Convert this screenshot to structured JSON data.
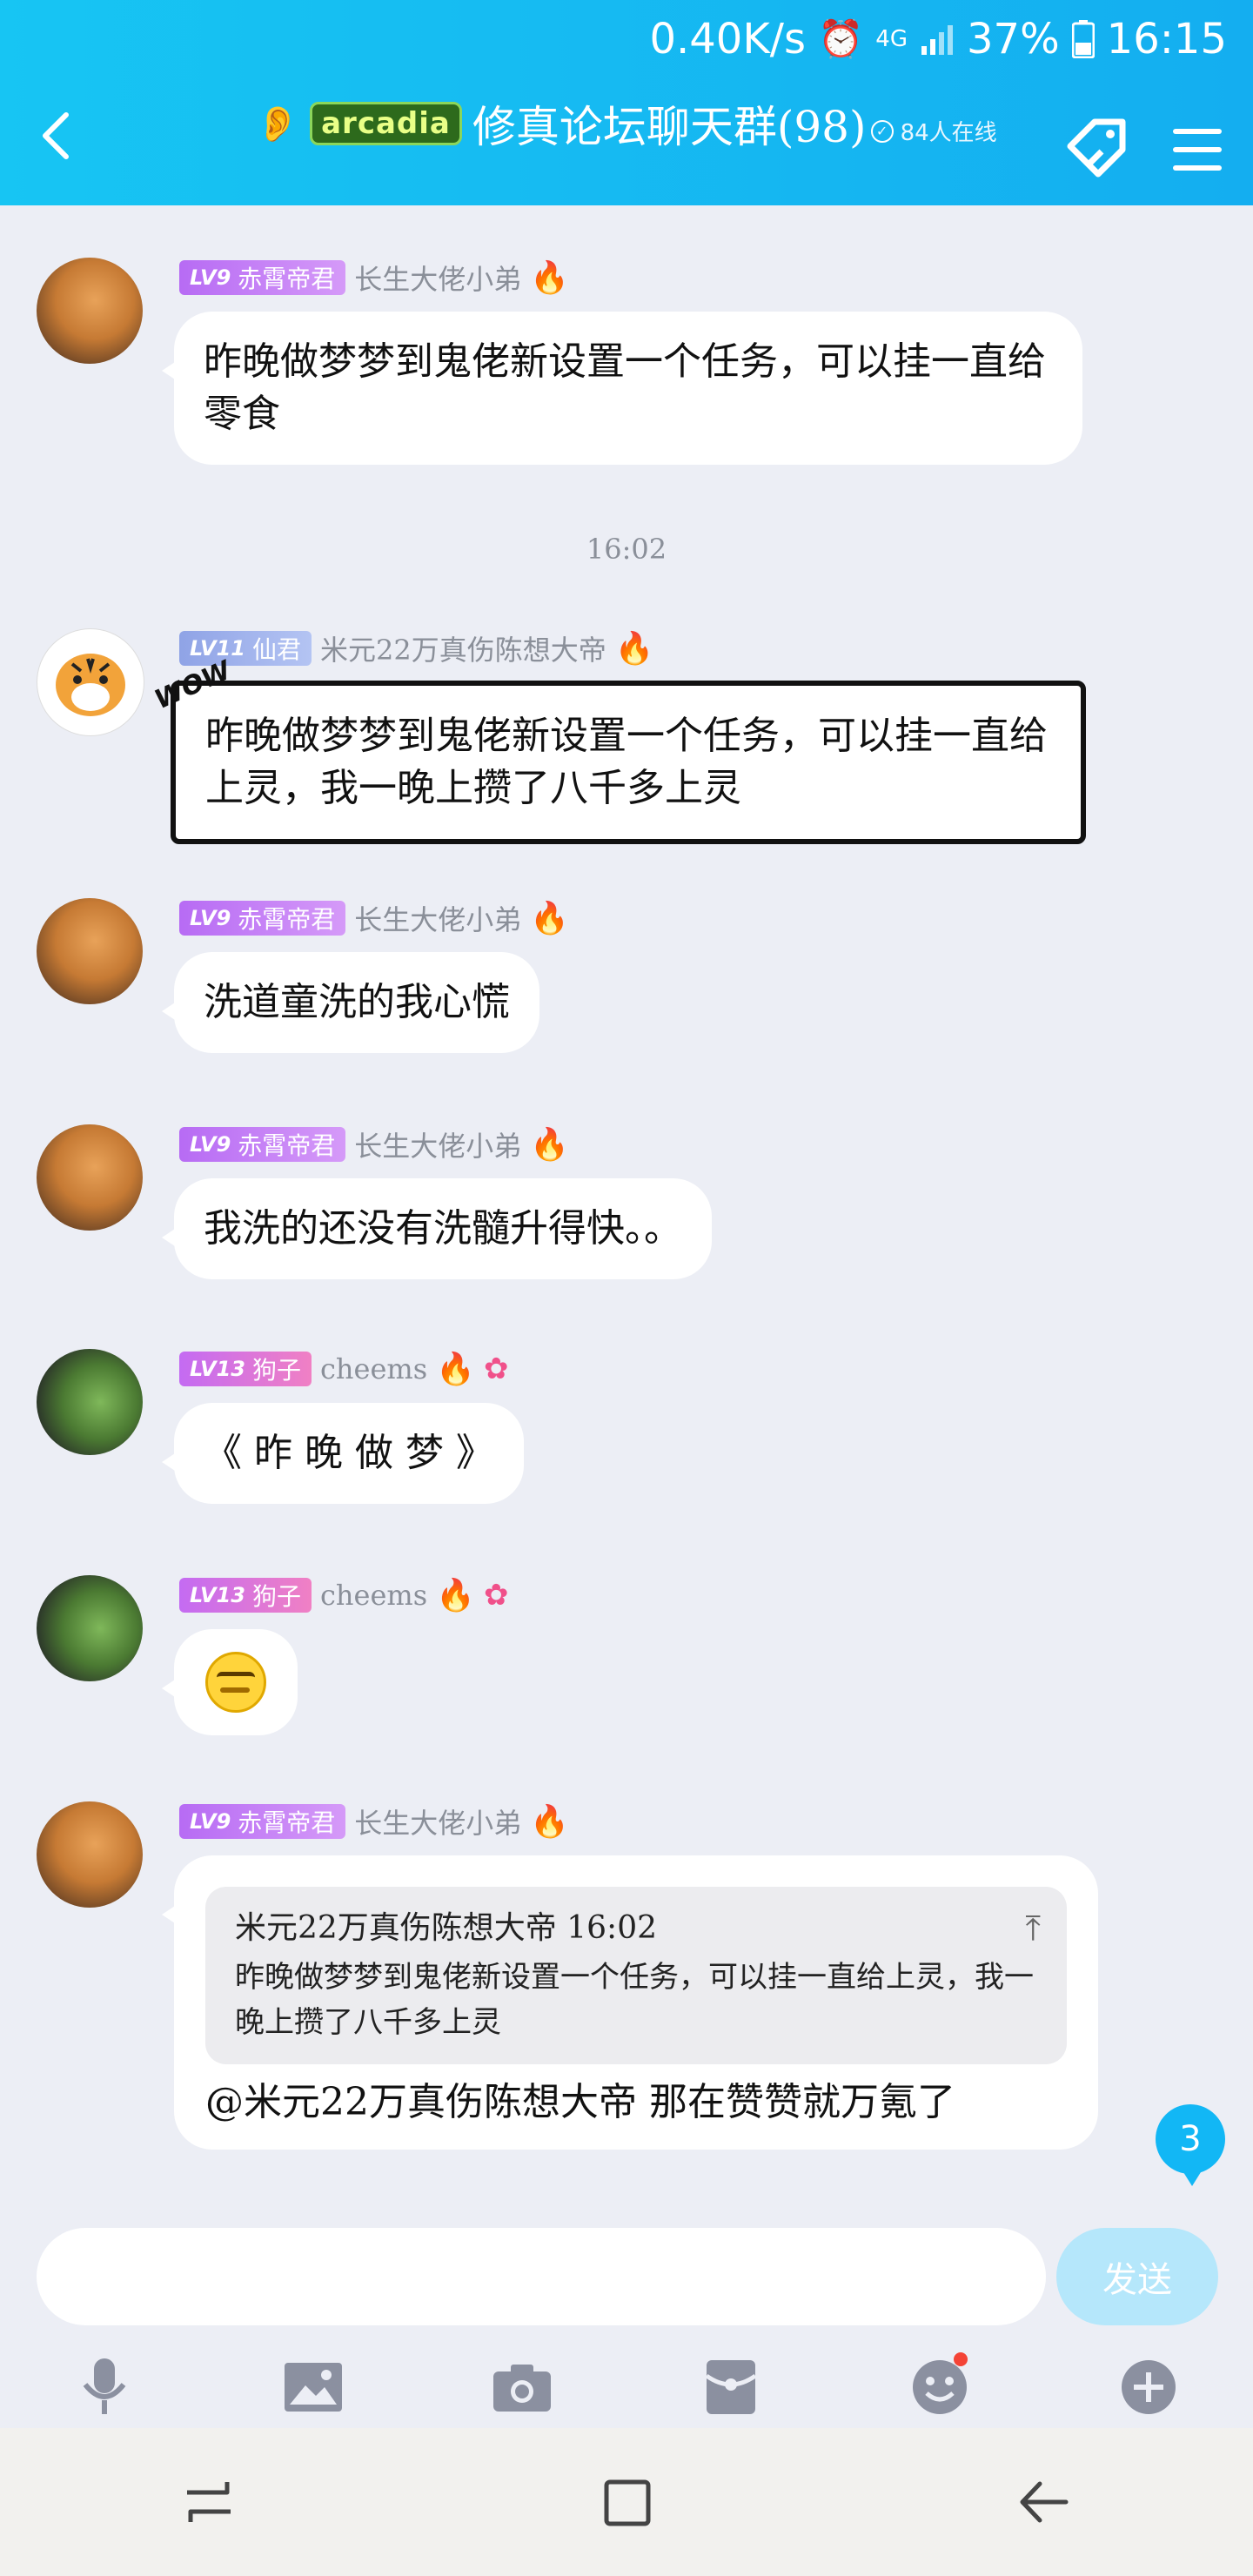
{
  "status_bar": {
    "net_speed": "0.40K/s",
    "network": "4G",
    "battery": "37%",
    "time": "16:15"
  },
  "header": {
    "logo_text": "arcadia",
    "title": "修真论坛聊天群(98)",
    "online": "84人在线"
  },
  "messages": [
    {
      "level": "LV9",
      "badge": "赤霄帝君",
      "nick": "长生大佬小弟",
      "text": "昨晚做梦梦到鬼佬新设置一个任务，可以挂一直给零食"
    },
    {
      "timestamp": "16:02"
    },
    {
      "level": "LV11",
      "badge": "仙君",
      "nick": "米元22万真伤陈想大帝",
      "sticker": "WOW",
      "text": "昨晚做梦梦到鬼佬新设置一个任务，可以挂一直给上灵，我一晚上攒了八千多上灵"
    },
    {
      "level": "LV9",
      "badge": "赤霄帝君",
      "nick": "长生大佬小弟",
      "text": "洗道童洗的我心慌"
    },
    {
      "level": "LV9",
      "badge": "赤霄帝君",
      "nick": "长生大佬小弟",
      "text": "我洗的还没有洗髓升得快。。"
    },
    {
      "level": "LV13",
      "badge": "狗子",
      "nick": "cheems",
      "text": "《 昨 晚 做 梦 》"
    },
    {
      "level": "LV13",
      "badge": "狗子",
      "nick": "cheems"
    },
    {
      "level": "LV9",
      "badge": "赤霄帝君",
      "nick": "长生大佬小弟",
      "quote_head": "米元22万真伤陈想大帝 16:02",
      "quote_text": "昨晚做梦梦到鬼佬新设置一个任务，可以挂一直给上灵，我一晚上攒了八千多上灵",
      "text": "@米元22万真伤陈想大帝 那在赞赞就万氪了"
    }
  ],
  "unread_count": "3",
  "input": {
    "placeholder": "",
    "send_label": "发送"
  },
  "colors": {
    "header": "#14aef0",
    "chat_bg": "#eceef5",
    "send_disabled": "#b5e7fb",
    "badge": "#12b7f5"
  }
}
